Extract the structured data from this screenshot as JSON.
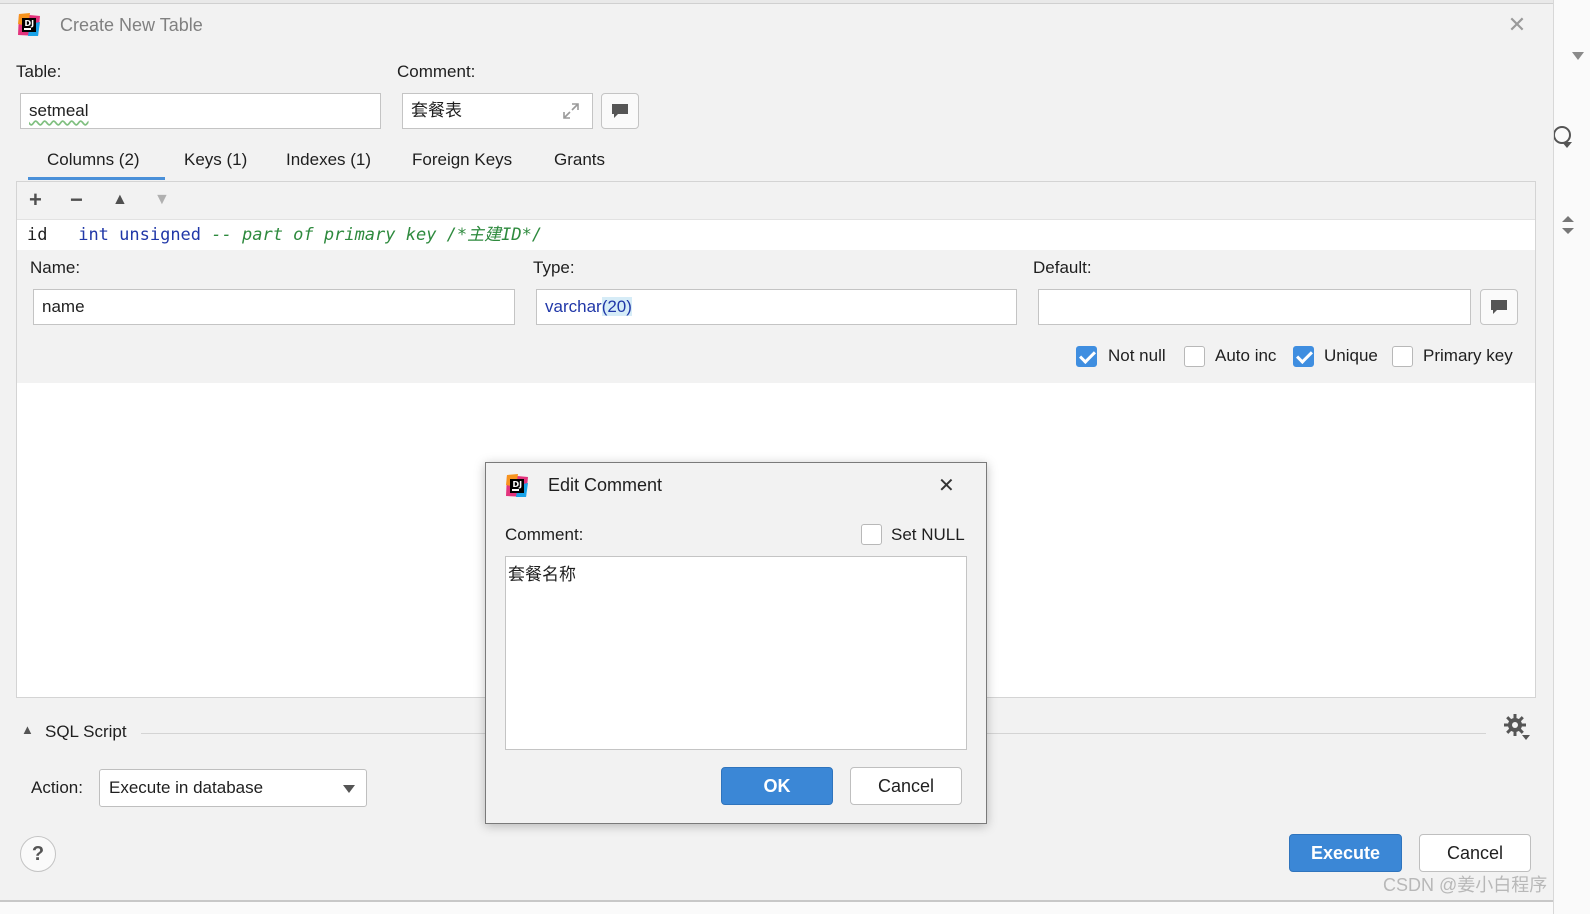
{
  "window": {
    "title": "Create New Table",
    "close_label": "✕"
  },
  "table": {
    "label": "Table:",
    "value": "setmeal"
  },
  "comment": {
    "label": "Comment:",
    "value": "套餐表"
  },
  "tabs": [
    {
      "label": "Columns (2)",
      "active": true
    },
    {
      "label": "Keys (1)"
    },
    {
      "label": "Indexes (1)"
    },
    {
      "label": "Foreign Keys"
    },
    {
      "label": "Grants"
    }
  ],
  "toolbar": {
    "add": "+",
    "remove": "−",
    "up": "▲",
    "down": "▼"
  },
  "column_row": {
    "name": "id",
    "type": "int unsigned",
    "comment": "-- part of primary key /*主建ID*/"
  },
  "column_editor": {
    "name_label": "Name:",
    "name_value": "name",
    "type_label": "Type:",
    "type_value_prefix": "varchar",
    "type_value_args": "(20)",
    "default_label": "Default:",
    "default_value": "",
    "checks": [
      {
        "label": "Not null",
        "checked": true
      },
      {
        "label": "Auto inc",
        "checked": false
      },
      {
        "label": "Unique",
        "checked": true
      },
      {
        "label": "Primary key",
        "checked": false
      }
    ]
  },
  "sql_script": {
    "label": "SQL Script",
    "arrow": "▲"
  },
  "action": {
    "label": "Action:",
    "value": "Execute in database"
  },
  "footer": {
    "help": "?",
    "execute": "Execute",
    "cancel": "Cancel"
  },
  "edit_comment_dialog": {
    "title": "Edit Comment",
    "close_label": "✕",
    "comment_label": "Comment:",
    "set_null_label": "Set NULL",
    "set_null_checked": false,
    "text": "套餐名称",
    "ok": "OK",
    "cancel": "Cancel"
  },
  "watermark": "CSDN @姜小白程序",
  "colors": {
    "accent": "#3b87d6",
    "keyword": "#2037a8",
    "comment_green": "#2e8a3e"
  }
}
